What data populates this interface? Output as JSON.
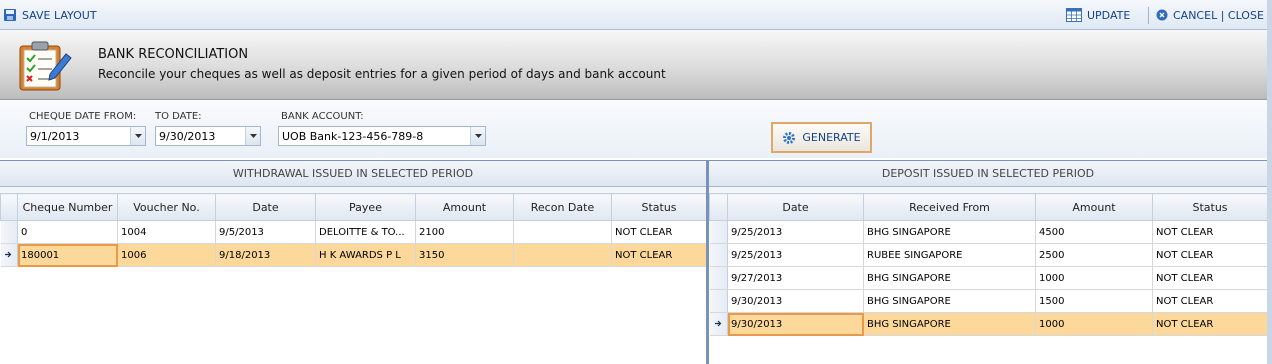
{
  "toolbar": {
    "save_layout": "SAVE LAYOUT",
    "update": "UPDATE",
    "cancel_close": "CANCEL | CLOSE"
  },
  "header": {
    "title": "BANK RECONCILIATION",
    "subtitle": "Reconcile your cheques as well as deposit entries for a given period of days and bank account"
  },
  "filters": {
    "from_label": "CHEQUE DATE FROM:",
    "from_value": "9/1/2013",
    "to_label": "TO DATE:",
    "to_value": "9/30/2013",
    "account_label": "BANK ACCOUNT:",
    "account_value": "UOB Bank-123-456-789-8",
    "generate": "GENERATE"
  },
  "withdrawal": {
    "title": "WITHDRAWAL ISSUED IN SELECTED PERIOD",
    "columns": [
      "Cheque Number",
      "Voucher No.",
      "Date",
      "Payee",
      "Amount",
      "Recon Date",
      "Status"
    ],
    "rows": [
      {
        "cheque": "0",
        "voucher": "1004",
        "date": "9/5/2013",
        "payee": "DELOITTE & TO...",
        "amount": "2100",
        "recon": "",
        "status": "NOT CLEAR"
      },
      {
        "cheque": "180001",
        "voucher": "1006",
        "date": "9/18/2013",
        "payee": "H K AWARDS P L",
        "amount": "3150",
        "recon": "",
        "status": "NOT CLEAR"
      }
    ]
  },
  "deposit": {
    "title": "DEPOSIT ISSUED IN SELECTED PERIOD",
    "columns": [
      "Date",
      "Received From",
      "Amount",
      "Status"
    ],
    "rows": [
      {
        "date": "9/25/2013",
        "from": "BHG SINGAPORE",
        "amount": "4500",
        "status": "NOT CLEAR"
      },
      {
        "date": "9/25/2013",
        "from": "RUBEE SINGAPORE",
        "amount": "2500",
        "status": "NOT CLEAR"
      },
      {
        "date": "9/27/2013",
        "from": "BHG SINGAPORE",
        "amount": "1000",
        "status": "NOT CLEAR"
      },
      {
        "date": "9/30/2013",
        "from": "BHG SINGAPORE",
        "amount": "1500",
        "status": "NOT CLEAR"
      },
      {
        "date": "9/30/2013",
        "from": "BHG SINGAPORE",
        "amount": "1000",
        "status": "NOT CLEAR"
      }
    ]
  },
  "icons": {
    "save": "floppy-disk-icon",
    "update": "table-grid-icon",
    "cancel": "cancel-circle-icon",
    "header": "clipboard-checklist-icon",
    "generate": "gear-icon",
    "row_indicator": "row-arrow-icon",
    "dropdown": "chevron-down-icon"
  },
  "colors": {
    "accent": "#15428b",
    "selected_row": "#fcd89b",
    "focus_border": "#e89a4a"
  }
}
